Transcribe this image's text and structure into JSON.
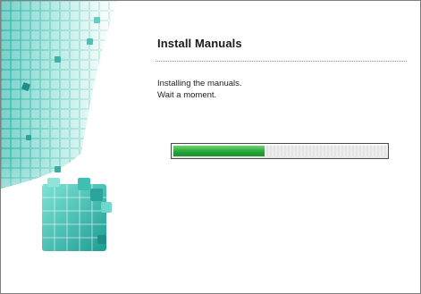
{
  "dialog": {
    "title": "Install Manuals",
    "message_lines": [
      "Installing the manuals.",
      "Wait a moment."
    ]
  },
  "progress": {
    "fraction": 0.43,
    "color": "#2aa83c"
  },
  "banner": {
    "icon": "teal-cube-graphic",
    "accent": "#2bb3a8"
  }
}
